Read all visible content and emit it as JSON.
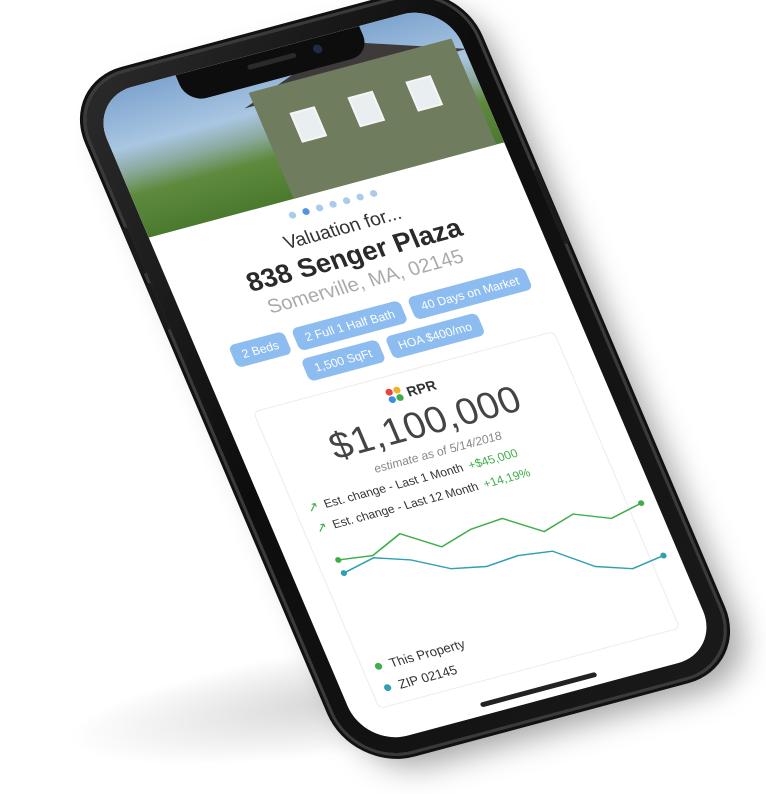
{
  "valuation_label": "Valuation for...",
  "address": "838 Senger Plaza",
  "city": "Somerville, MA, 02145",
  "carousel": {
    "count": 7,
    "active_index": 1
  },
  "tags": [
    "2 Beds",
    "2 Full 1 Half Bath",
    "40 Days on Market",
    "1,500 SqFt",
    "HOA $400/mo"
  ],
  "card": {
    "brand": "RPR",
    "price": "$1,100,000",
    "estimate_text": "estimate as of 5/14/2018",
    "changes": [
      {
        "label": "Est. change - Last 1 Month",
        "value": "+$45,000"
      },
      {
        "label": "Est. change - Last 12 Month",
        "value": "+14,19%"
      }
    ]
  },
  "chart_data": {
    "type": "line",
    "series": [
      {
        "name": "This Property",
        "color": "#3fae49",
        "values": [
          5.2,
          5.0,
          5.6,
          4.6,
          5.0,
          5.1,
          4.1,
          4.5,
          3.9,
          4.2
        ]
      },
      {
        "name": "ZIP 02145",
        "color": "#2f9fb4",
        "values": [
          4.6,
          4.9,
          4.4,
          3.6,
          3.3,
          3.4,
          3.2,
          2.1,
          1.6,
          1.8
        ]
      }
    ]
  },
  "legend": {
    "this_property": "This Property",
    "zip": "ZIP 02145"
  },
  "colors": {
    "tag_bg": "#8dbcf0",
    "dot_active": "#4f95e0",
    "dot_inactive": "#a9cbee",
    "positive": "#3fae49"
  }
}
